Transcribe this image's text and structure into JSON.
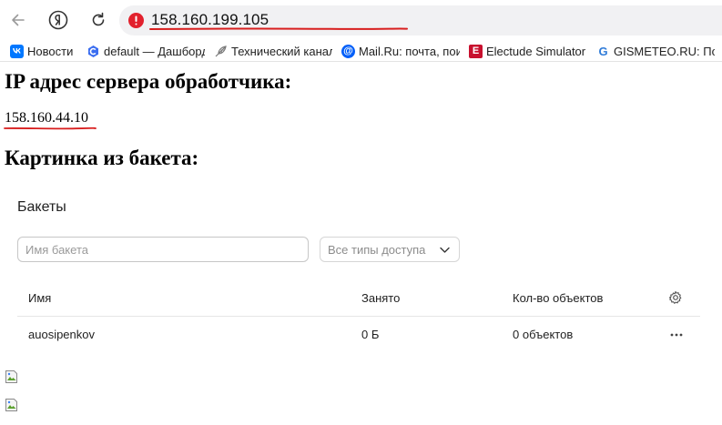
{
  "browser": {
    "address": "158.160.199.105",
    "colors": {
      "warning": "#e2212d",
      "annotation": "#d81e1e"
    }
  },
  "bookmarks": [
    {
      "label": "Новости",
      "icon": "vk-icon",
      "color": "#0077ff",
      "glyph": "vk"
    },
    {
      "label": "default — Дашборд",
      "icon": "cloud-c-icon",
      "color": "#3a6df0",
      "glyph": "c"
    },
    {
      "label": "Технический канал",
      "icon": "feather-icon",
      "color": "#888888",
      "glyph": ""
    },
    {
      "label": "Mail.Ru: почта, поиск",
      "icon": "at-icon",
      "color": "#005ff9",
      "glyph": "@"
    },
    {
      "label": "Electude Simulator",
      "icon": "electude-icon",
      "color": "#c8102e",
      "glyph": "E"
    },
    {
      "label": "GISMETEO.RU: Погода",
      "icon": "gismeteo-icon",
      "color": "#2f7bd8",
      "glyph": "G"
    }
  ],
  "page": {
    "server_heading": "IP адрес сервера обработчика:",
    "server_ip": "158.160.44.10",
    "picture_heading": "Картинка из бакета:"
  },
  "console": {
    "title": "Бакеты",
    "search_placeholder": "Имя бакета",
    "access_filter": "Все типы доступа",
    "columns": {
      "name": "Имя",
      "size": "Занято",
      "count": "Кол-во объектов"
    },
    "rows": [
      {
        "name": "auosipenkov",
        "size": "0 Б",
        "count": "0 объектов"
      }
    ]
  }
}
